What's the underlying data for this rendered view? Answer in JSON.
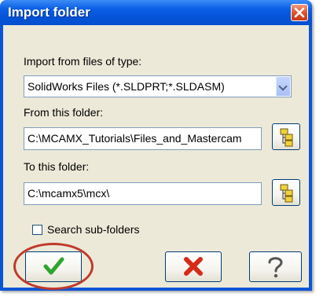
{
  "window": {
    "title": "Import folder"
  },
  "import_type": {
    "label": "Import from files of type:",
    "selected": "SolidWorks Files (*.SLDPRT;*.SLDASM)"
  },
  "from_folder": {
    "label": "From this folder:",
    "value": "C:\\MCAMX_Tutorials\\Files_and_Mastercam"
  },
  "to_folder": {
    "label": "To this folder:",
    "value": "C:\\mcamx5\\mcx\\"
  },
  "search_subfolders": {
    "label": "Search sub-folders",
    "checked": false
  },
  "icons": {
    "close": "close-icon",
    "browse": "folder-tree-icon",
    "ok": "checkmark-icon",
    "cancel": "red-x-icon",
    "help": "question-mark-icon"
  },
  "colors": {
    "title_bar": "#0453d6",
    "dialog_bg": "#ece9d8",
    "ok_check": "#2fa52f",
    "cancel_x": "#d62a1a",
    "highlight": "#c0392b"
  }
}
